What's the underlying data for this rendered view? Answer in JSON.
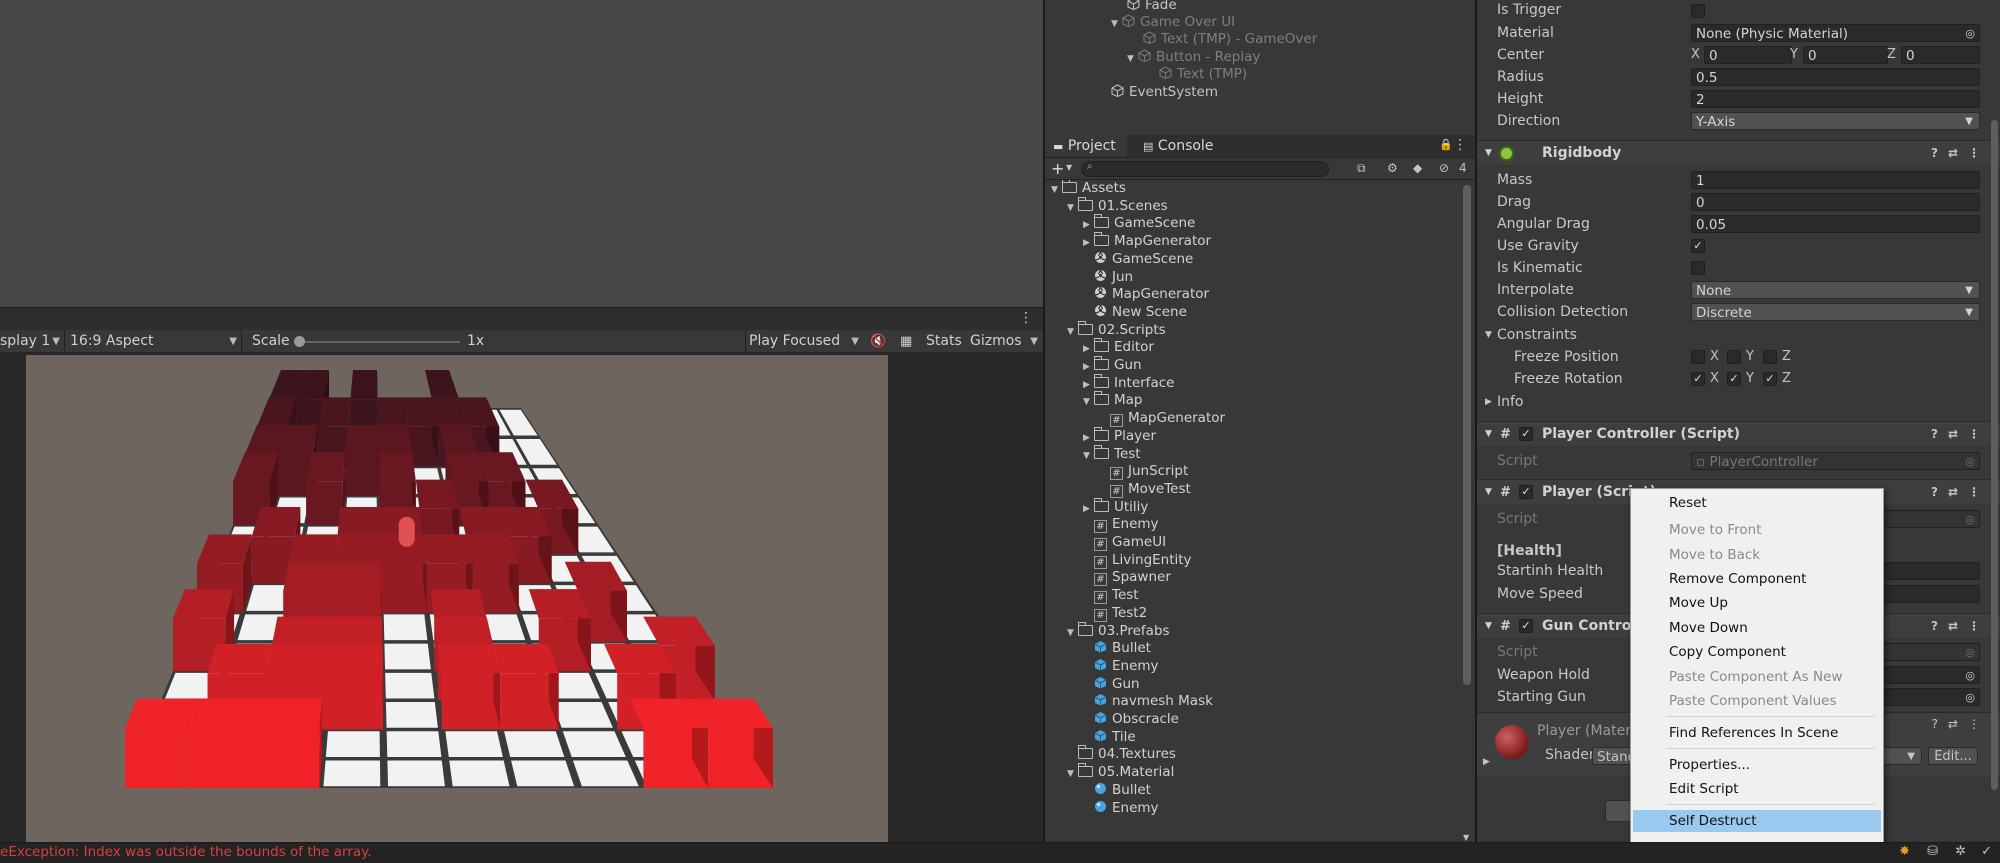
{
  "hierarchy": {
    "items": [
      {
        "label": "Fade",
        "dim": false
      },
      {
        "label": "Game Over UI",
        "dim": true
      },
      {
        "label": "Text (TMP) - GameOver",
        "dim": true
      },
      {
        "label": "Button - Replay",
        "dim": true
      },
      {
        "label": "Text (TMP)",
        "dim": true
      },
      {
        "label": "EventSystem",
        "dim": false
      }
    ]
  },
  "game_view": {
    "display": "splay 1",
    "aspect": "16:9 Aspect",
    "scale_label": "Scale",
    "scale_value": "1x",
    "play_mode": "Play Focused",
    "stats": "Stats",
    "gizmos": "Gizmos"
  },
  "project": {
    "tabs": {
      "project": "Project",
      "console": "Console"
    },
    "hidden_count": "4",
    "tree": [
      {
        "label": "Assets",
        "type": "folder",
        "level": 0,
        "arrow": "open"
      },
      {
        "label": "01.Scenes",
        "type": "folder",
        "level": 1,
        "arrow": "open"
      },
      {
        "label": "GameScene",
        "type": "folder",
        "level": 2,
        "arrow": "closed"
      },
      {
        "label": "MapGenerator",
        "type": "folder",
        "level": 2,
        "arrow": "closed"
      },
      {
        "label": "GameScene",
        "type": "scene",
        "level": 2,
        "arrow": ""
      },
      {
        "label": "Jun",
        "type": "scene",
        "level": 2,
        "arrow": ""
      },
      {
        "label": "MapGenerator",
        "type": "scene",
        "level": 2,
        "arrow": ""
      },
      {
        "label": "New Scene",
        "type": "scene",
        "level": 2,
        "arrow": ""
      },
      {
        "label": "02.Scripts",
        "type": "folder",
        "level": 1,
        "arrow": "open"
      },
      {
        "label": "Editor",
        "type": "folder",
        "level": 2,
        "arrow": "closed"
      },
      {
        "label": "Gun",
        "type": "folder",
        "level": 2,
        "arrow": "closed"
      },
      {
        "label": "Interface",
        "type": "folder",
        "level": 2,
        "arrow": "closed"
      },
      {
        "label": "Map",
        "type": "folder",
        "level": 2,
        "arrow": "open"
      },
      {
        "label": "MapGenerator",
        "type": "script",
        "level": 3,
        "arrow": ""
      },
      {
        "label": "Player",
        "type": "folder",
        "level": 2,
        "arrow": "closed"
      },
      {
        "label": "Test",
        "type": "folder",
        "level": 2,
        "arrow": "open"
      },
      {
        "label": "JunScript",
        "type": "script",
        "level": 3,
        "arrow": ""
      },
      {
        "label": "MoveTest",
        "type": "script",
        "level": 3,
        "arrow": ""
      },
      {
        "label": "Utiliy",
        "type": "folder",
        "level": 2,
        "arrow": "closed"
      },
      {
        "label": "Enemy",
        "type": "script",
        "level": 2,
        "arrow": ""
      },
      {
        "label": "GameUI",
        "type": "script",
        "level": 2,
        "arrow": ""
      },
      {
        "label": "LivingEntity",
        "type": "script",
        "level": 2,
        "arrow": ""
      },
      {
        "label": "Spawner",
        "type": "script",
        "level": 2,
        "arrow": ""
      },
      {
        "label": "Test",
        "type": "script",
        "level": 2,
        "arrow": ""
      },
      {
        "label": "Test2",
        "type": "script",
        "level": 2,
        "arrow": ""
      },
      {
        "label": "03.Prefabs",
        "type": "folder",
        "level": 1,
        "arrow": "open"
      },
      {
        "label": "Bullet",
        "type": "prefab",
        "level": 2,
        "arrow": ""
      },
      {
        "label": "Enemy",
        "type": "prefab",
        "level": 2,
        "arrow": ""
      },
      {
        "label": "Gun",
        "type": "prefab",
        "level": 2,
        "arrow": ""
      },
      {
        "label": "navmesh Mask",
        "type": "prefab",
        "level": 2,
        "arrow": ""
      },
      {
        "label": "Obscracle",
        "type": "prefab",
        "level": 2,
        "arrow": ""
      },
      {
        "label": "Tile",
        "type": "prefab",
        "level": 2,
        "arrow": ""
      },
      {
        "label": "04.Textures",
        "type": "folder",
        "level": 1,
        "arrow": ""
      },
      {
        "label": "05.Material",
        "type": "folder",
        "level": 1,
        "arrow": "open"
      },
      {
        "label": "Bullet",
        "type": "material",
        "level": 2,
        "arrow": ""
      },
      {
        "label": "Enemy",
        "type": "material",
        "level": 2,
        "arrow": ""
      }
    ]
  },
  "inspector": {
    "collider": {
      "is_trigger": "Is Trigger",
      "material": "Material",
      "material_value": "None (Physic Material)",
      "center": "Center",
      "cx": "0",
      "cy": "0",
      "cz": "0",
      "x": "X",
      "y": "Y",
      "z": "Z",
      "radius": "Radius",
      "radius_value": "0.5",
      "height": "Height",
      "height_value": "2",
      "direction": "Direction",
      "direction_value": "Y-Axis"
    },
    "rigidbody": {
      "title": "Rigidbody",
      "mass": "Mass",
      "mass_value": "1",
      "drag": "Drag",
      "drag_value": "0",
      "angular_drag": "Angular Drag",
      "angular_drag_value": "0.05",
      "use_gravity": "Use Gravity",
      "is_kinematic": "Is Kinematic",
      "interpolate": "Interpolate",
      "interpolate_value": "None",
      "collision": "Collision Detection",
      "collision_value": "Discrete",
      "constraints": "Constraints",
      "freeze_position": "Freeze Position",
      "freeze_rotation": "Freeze Rotation",
      "info": "Info"
    },
    "player_controller": {
      "title": "Player Controller (Script)",
      "script": "Script",
      "script_value": "PlayerController"
    },
    "player": {
      "title": "Player (Script)",
      "script": "Script",
      "health_header": "[Health]",
      "starting_health": "Startinh Health",
      "move_speed": "Move Speed"
    },
    "gun_controller": {
      "title": "Gun Controller (Script)",
      "script": "Script",
      "weapon_hold": "Weapon Hold",
      "starting_gun": "Starting Gun"
    },
    "material": {
      "title": "Player (Material)",
      "shader": "Shader",
      "shader_value": "Standard",
      "edit": "Edit..."
    }
  },
  "context_menu": {
    "items": [
      {
        "label": "Reset",
        "disabled": false
      },
      {
        "label": "Move to Front",
        "disabled": true
      },
      {
        "label": "Move to Back",
        "disabled": true
      },
      {
        "label": "Remove Component",
        "disabled": false
      },
      {
        "label": "Move Up",
        "disabled": false
      },
      {
        "label": "Move Down",
        "disabled": false
      },
      {
        "label": "Copy Component",
        "disabled": false
      },
      {
        "label": "Paste Component As New",
        "disabled": true
      },
      {
        "label": "Paste Component Values",
        "disabled": true
      },
      {
        "label": "Find References In Scene",
        "disabled": false
      },
      {
        "label": "Properties...",
        "disabled": false
      },
      {
        "label": "Edit Script",
        "disabled": false
      },
      {
        "label": "Self Destruct",
        "disabled": false,
        "selected": true
      }
    ]
  },
  "status": {
    "error": "eException: Index was outside the bounds of the array."
  },
  "colors": {
    "accent": "#99c9ef",
    "error": "#d94040",
    "folder": "#bbbbbb"
  }
}
